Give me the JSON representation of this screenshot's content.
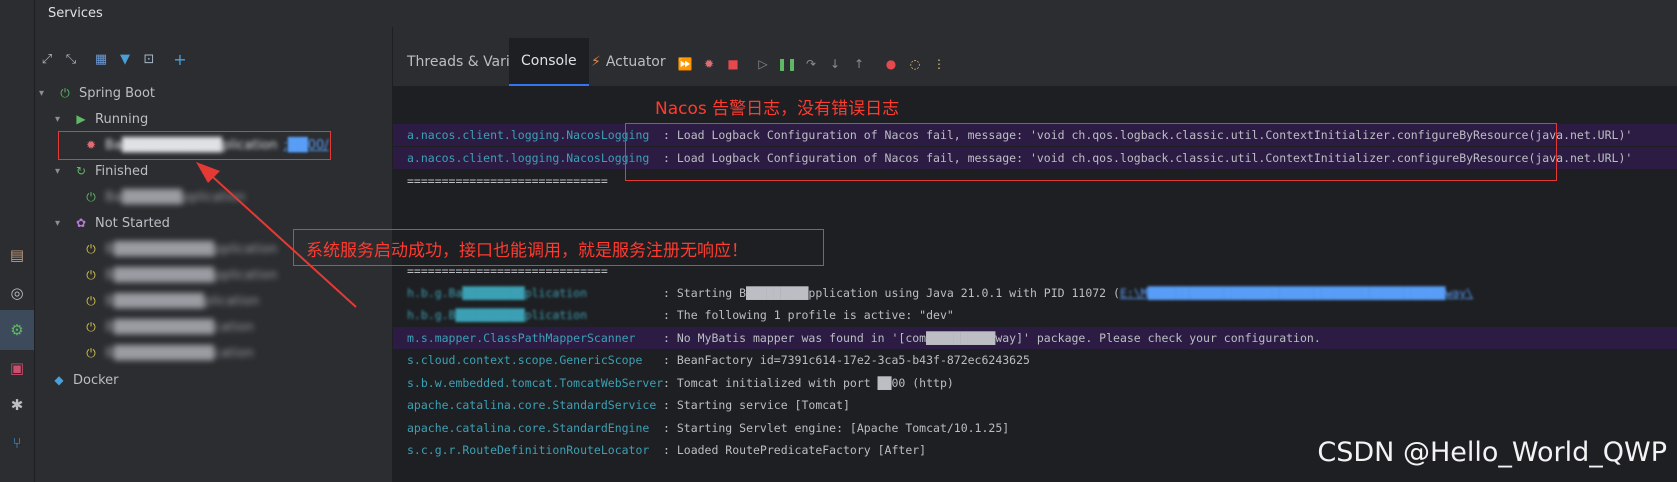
{
  "panel_title": "Services",
  "tree": {
    "spring_boot": "Spring Boot",
    "running": "Running",
    "running_app": "Ba██████████plication",
    "running_port": ":██00/",
    "finished": "Finished",
    "finished_app": "Ba██████pplication",
    "not_started": "Not Started",
    "ns_apps": [
      "B██████████pplication",
      "B██████████pplication",
      "B█████████plication",
      "B██████████cation",
      "B██████████cation"
    ],
    "docker": "Docker"
  },
  "tabs": {
    "threads": "Threads & Variables",
    "console": "Console",
    "actuator": "Actuator"
  },
  "console": {
    "lines": [
      {
        "src": "a.nacos.client.logging.NacosLogging",
        "msg": ": Load Logback Configuration of Nacos fail, message: 'void ch.qos.logback.classic.util.ContextInitializer.configureByResource(java.net.URL)'"
      },
      {
        "src": "a.nacos.client.logging.NacosLogging",
        "msg": ": Load Logback Configuration of Nacos fail, message: 'void ch.qos.logback.classic.util.ContextInitializer.configureByResource(java.net.URL)'"
      },
      {
        "src": "h.b.g.Ba█████████plication",
        "msg": ": Starting B█████████pplication using Java 21.0.1 with PID 11072 (",
        "link": "E:\\M███████████████████████████████████████████way\\"
      },
      {
        "src": "h.b.g.B██████████plication",
        "msg": ": The following 1 profile is active: \"dev\""
      },
      {
        "src": "m.s.mapper.ClassPathMapperScanner",
        "msg": ": No MyBatis mapper was found in '[com██████████way]' package. Please check your configuration."
      },
      {
        "src": "s.cloud.context.scope.GenericScope",
        "msg": ": BeanFactory id=7391c614-17e2-3ca5-b43f-872ec6243625"
      },
      {
        "src": "s.b.w.embedded.tomcat.TomcatWebServer",
        "msg": ": Tomcat initialized with port ██00 (http)"
      },
      {
        "src": "apache.catalina.core.StandardService",
        "msg": ": Starting service [Tomcat]"
      },
      {
        "src": "apache.catalina.core.StandardEngine",
        "msg": ": Starting Servlet engine: [Apache Tomcat/10.1.25]"
      },
      {
        "src": "s.c.g.r.RouteDefinitionRouteLocator",
        "msg": ": Loaded RoutePredicateFactory [After]"
      }
    ],
    "separator": "============================="
  },
  "annotations": {
    "nacos": "Nacos 告警日志，没有错误日志",
    "service": "系统服务启动成功，接口也能调用，就是服务注册无响应！"
  },
  "watermark": "CSDN @Hello_World_QWP",
  "colors": {
    "accent": "#3574f0",
    "annotation": "#ff3b30",
    "logger": "#3ca0b4",
    "highlight": "#2c1c44"
  }
}
